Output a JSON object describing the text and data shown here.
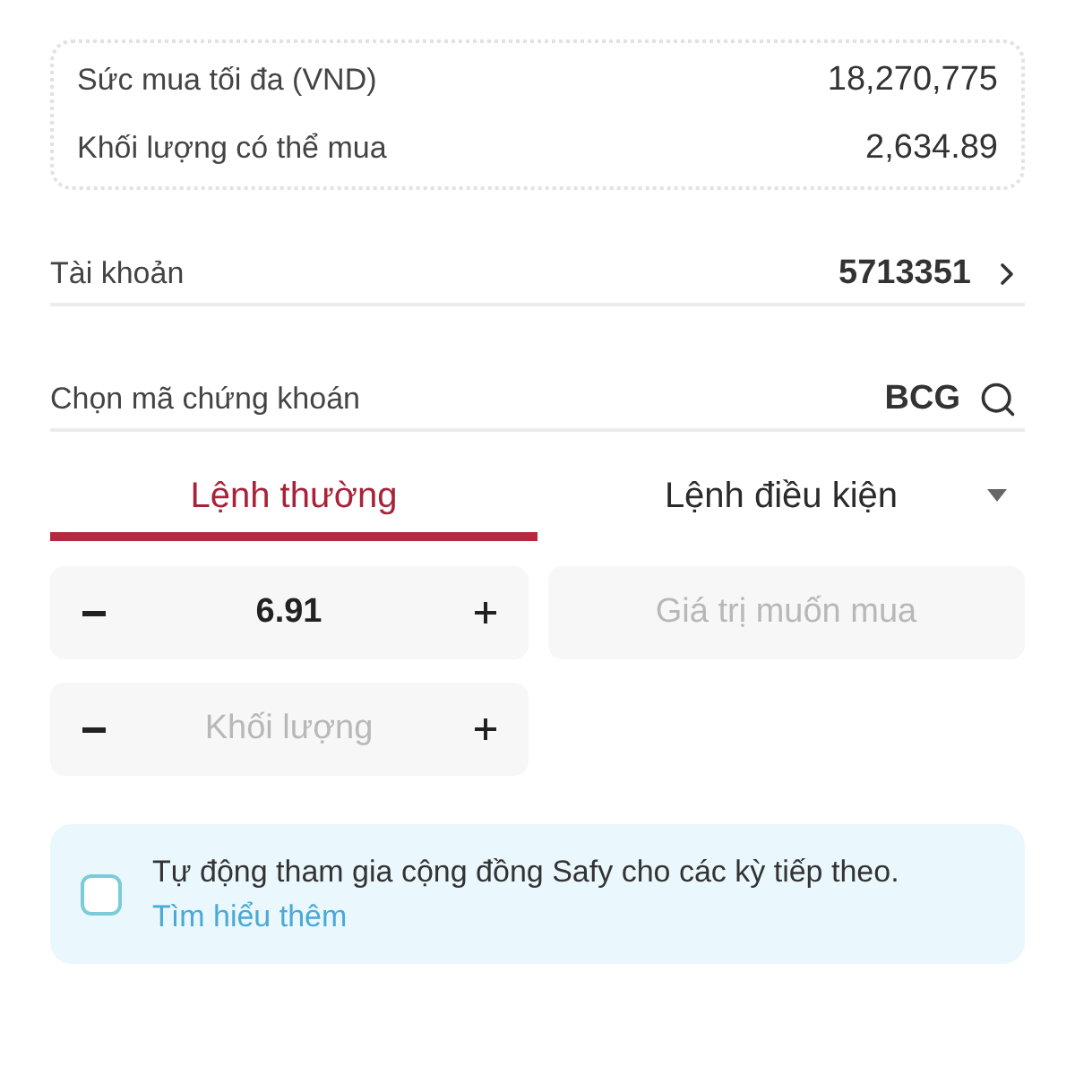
{
  "purchasing_summary": [
    {
      "label": "Sức mua tối đa (VND)",
      "value": "18,270,775"
    },
    {
      "label": "Khối lượng có thể mua",
      "value": "2,634.89"
    }
  ],
  "account": {
    "label": "Tài khoản",
    "value": "5713351"
  },
  "stock_picker": {
    "label": "Chọn mã chứng khoán",
    "value": "BCG"
  },
  "order_tabs": [
    {
      "label": "Lệnh thường",
      "selected": true,
      "kind": "tab"
    },
    {
      "label": "Lệnh điều kiện",
      "selected": false,
      "kind": "dropdown"
    }
  ],
  "order_fields": [
    {
      "kind": "stepper",
      "value": "6.91"
    },
    {
      "kind": "text",
      "placeholder": "Giá trị muốn mua"
    },
    {
      "kind": "stepper",
      "placeholder": "Khối lượng"
    }
  ],
  "auto_join": {
    "checked": false,
    "text": "Tự động tham gia cộng đồng Safy cho các kỳ tiếp theo.",
    "link": "Tìm hiểu thêm"
  }
}
